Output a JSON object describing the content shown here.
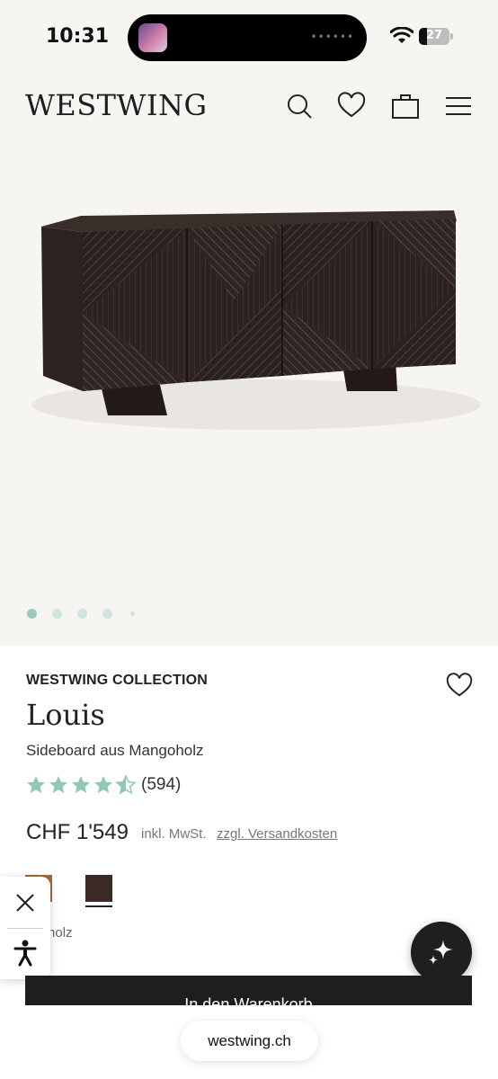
{
  "status_bar": {
    "time": "10:31",
    "battery": "27"
  },
  "header": {
    "logo": "WESTWING"
  },
  "gallery": {
    "dots_count": 5,
    "active_index": 0
  },
  "product": {
    "brand": "WESTWING COLLECTION",
    "name": "Louis",
    "subtitle": "Sideboard aus Mangoholz",
    "rating": 4.5,
    "rating_count": "(594)",
    "price": "CHF 1'549",
    "vat_label": "inkl. MwSt.",
    "shipping_link": "zzgl. Versandkosten",
    "material_label": "ngoholz",
    "swatches": [
      {
        "color": "#a36a3a",
        "selected": false
      },
      {
        "color": "#3c2a26",
        "selected": true
      }
    ]
  },
  "cart_button": {
    "label": "In den Warenkorb"
  },
  "browser": {
    "url": "westwing.ch"
  },
  "colors": {
    "star": "#8fc7b9",
    "dot_active": "#9dc9bd",
    "dot_inactive": "#cfe6e0"
  }
}
